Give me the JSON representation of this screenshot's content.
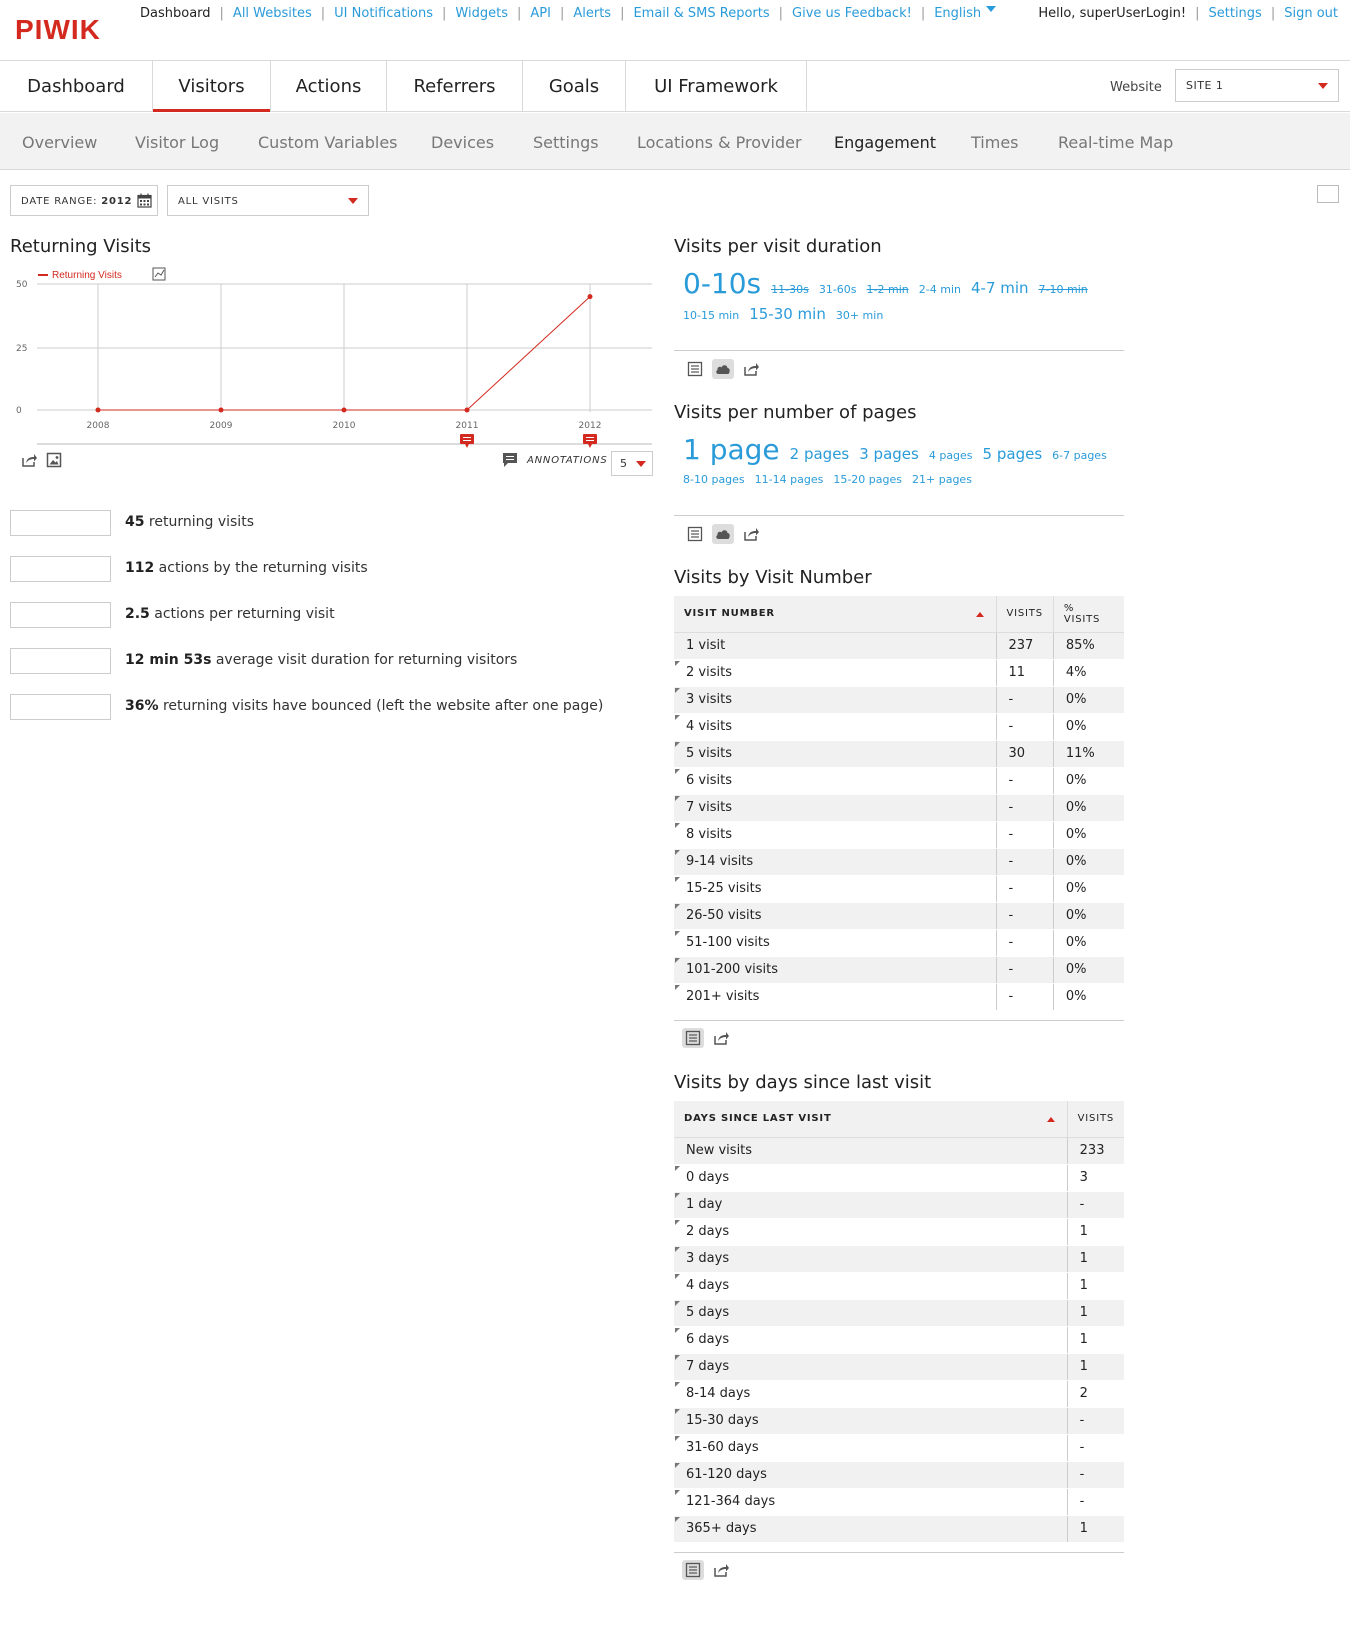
{
  "logo": "PIWIK",
  "topnav": {
    "items": [
      "Dashboard",
      "All Websites",
      "UI Notifications",
      "Widgets",
      "API",
      "Alerts",
      "Email & SMS Reports",
      "Give us Feedback!",
      "English"
    ],
    "hello": "Hello, superUserLogin!",
    "settings": "Settings",
    "signout": "Sign out"
  },
  "mainmenu": {
    "tabs": [
      "Dashboard",
      "Visitors",
      "Actions",
      "Referrers",
      "Goals",
      "UI Framework"
    ],
    "active": "Visitors",
    "website_label": "Website",
    "site_value": "SITE 1"
  },
  "submenu": {
    "items": [
      "Overview",
      "Visitor Log",
      "Custom Variables",
      "Devices",
      "Settings",
      "Locations & Provider",
      "Engagement",
      "Times",
      "Real-time Map"
    ],
    "active": "Engagement"
  },
  "controls": {
    "date_label": "DATE RANGE:",
    "date_value": "2012",
    "segment": "ALL VISITS"
  },
  "returning": {
    "title": "Returning Visits",
    "annotations_label": "ANNOTATIONS",
    "limit_value": "5",
    "sparklines": [
      {
        "value": "45",
        "text": " returning visits"
      },
      {
        "value": "112",
        "text": " actions by the returning visits"
      },
      {
        "value": "2.5",
        "text": " actions per returning visit"
      },
      {
        "value": "12 min 53s",
        "text": " average visit duration for returning visitors"
      },
      {
        "value": "36%",
        "text": " returning visits have bounced (left the website after one page)"
      }
    ]
  },
  "chart_data": {
    "type": "line",
    "x": [
      "2008",
      "2009",
      "2010",
      "2011",
      "2012"
    ],
    "series": [
      {
        "name": "Returning Visits",
        "values": [
          0,
          0,
          0,
          0,
          45
        ]
      }
    ],
    "yticks": [
      "0",
      "25",
      "50"
    ],
    "ylim": [
      0,
      50
    ],
    "color": "#d4291f",
    "annotations_on": [
      "2011",
      "2012"
    ],
    "grid": true,
    "legend": "top-left"
  },
  "duration": {
    "title": "Visits per visit duration",
    "tags": [
      {
        "label": "0-10s",
        "size": 28,
        "strike": false
      },
      {
        "label": "11-30s",
        "size": 11,
        "strike": true
      },
      {
        "label": "31-60s",
        "size": 11,
        "strike": false
      },
      {
        "label": "1-2 min",
        "size": 11,
        "strike": true
      },
      {
        "label": "2-4 min",
        "size": 11,
        "strike": false
      },
      {
        "label": "4-7 min",
        "size": 15,
        "strike": false
      },
      {
        "label": "7-10 min",
        "size": 11,
        "strike": true
      },
      {
        "label": "10-15 min",
        "size": 11,
        "strike": false
      },
      {
        "label": "15-30 min",
        "size": 15,
        "strike": false
      },
      {
        "label": "30+ min",
        "size": 11,
        "strike": false
      }
    ]
  },
  "pages": {
    "title": "Visits per number of pages",
    "tags": [
      {
        "label": "1 page",
        "size": 28,
        "strike": false
      },
      {
        "label": "2 pages",
        "size": 15,
        "strike": false
      },
      {
        "label": "3 pages",
        "size": 15,
        "strike": false
      },
      {
        "label": "4 pages",
        "size": 11,
        "strike": false
      },
      {
        "label": "5 pages",
        "size": 15,
        "strike": false
      },
      {
        "label": "6-7 pages",
        "size": 11,
        "strike": false
      },
      {
        "label": "8-10 pages",
        "size": 11,
        "strike": false
      },
      {
        "label": "11-14 pages",
        "size": 11,
        "strike": false
      },
      {
        "label": "15-20 pages",
        "size": 11,
        "strike": false
      },
      {
        "label": "21+ pages",
        "size": 11,
        "strike": false
      }
    ]
  },
  "visit_number": {
    "title": "Visits by Visit Number",
    "columns": [
      "VISIT NUMBER",
      "VISITS",
      "% VISITS"
    ],
    "rows": [
      [
        "1 visit",
        "237",
        "85%"
      ],
      [
        "2 visits",
        "11",
        "4%"
      ],
      [
        "3 visits",
        "-",
        "0%"
      ],
      [
        "4 visits",
        "-",
        "0%"
      ],
      [
        "5 visits",
        "30",
        "11%"
      ],
      [
        "6 visits",
        "-",
        "0%"
      ],
      [
        "7 visits",
        "-",
        "0%"
      ],
      [
        "8 visits",
        "-",
        "0%"
      ],
      [
        "9-14 visits",
        "-",
        "0%"
      ],
      [
        "15-25 visits",
        "-",
        "0%"
      ],
      [
        "26-50 visits",
        "-",
        "0%"
      ],
      [
        "51-100 visits",
        "-",
        "0%"
      ],
      [
        "101-200 visits",
        "-",
        "0%"
      ],
      [
        "201+ visits",
        "-",
        "0%"
      ]
    ]
  },
  "days_since": {
    "title": "Visits by days since last visit",
    "columns": [
      "DAYS SINCE LAST VISIT",
      "VISITS"
    ],
    "rows": [
      [
        "New visits",
        "233"
      ],
      [
        "0 days",
        "3"
      ],
      [
        "1 day",
        "-"
      ],
      [
        "2 days",
        "1"
      ],
      [
        "3 days",
        "1"
      ],
      [
        "4 days",
        "1"
      ],
      [
        "5 days",
        "1"
      ],
      [
        "6 days",
        "1"
      ],
      [
        "7 days",
        "1"
      ],
      [
        "8-14 days",
        "2"
      ],
      [
        "15-30 days",
        "-"
      ],
      [
        "31-60 days",
        "-"
      ],
      [
        "61-120 days",
        "-"
      ],
      [
        "121-364 days",
        "-"
      ],
      [
        "365+ days",
        "1"
      ]
    ]
  }
}
